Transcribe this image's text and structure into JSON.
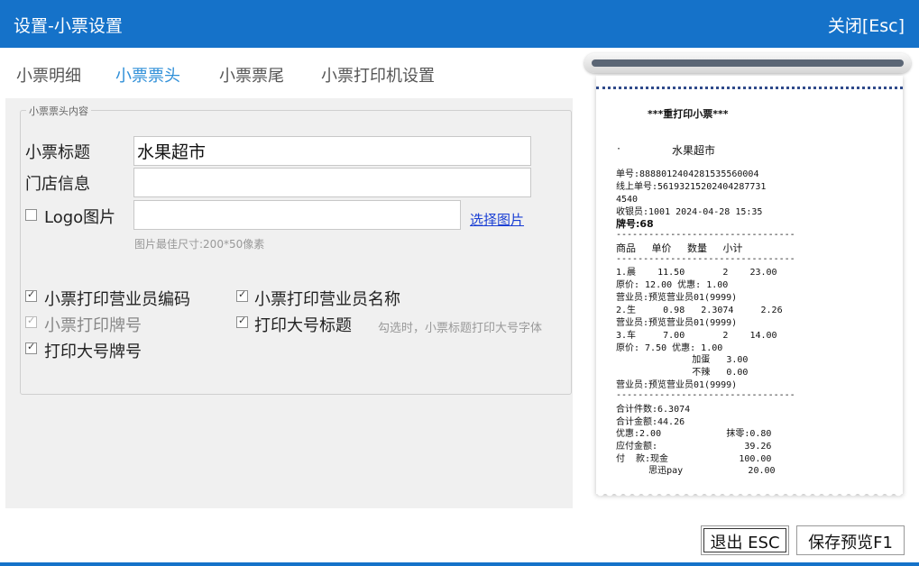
{
  "window": {
    "title": "设置-小票设置",
    "close_label": "关闭[Esc]"
  },
  "tabs": [
    {
      "label": "小票明细",
      "active": false
    },
    {
      "label": "小票票头",
      "active": true
    },
    {
      "label": "小票票尾",
      "active": false
    },
    {
      "label": "小票打印机设置",
      "active": false
    }
  ],
  "form": {
    "group_title": "小票票头内容",
    "title_label": "小票标题",
    "title_value": "水果超市",
    "store_label": "门店信息",
    "store_value": "",
    "logo_label": "Logo图片",
    "logo_checked": false,
    "logo_value": "",
    "choose_image": "选择图片",
    "image_hint": "图片最佳尺寸:200*50像素",
    "options": [
      {
        "label": "小票打印营业员编码",
        "checked": true,
        "disabled": false
      },
      {
        "label": "小票打印营业员名称",
        "checked": true,
        "disabled": false
      },
      {
        "label": "小票打印牌号",
        "checked": true,
        "disabled": true
      },
      {
        "label": "打印大号标题",
        "checked": true,
        "disabled": false
      },
      {
        "label": "打印大号牌号",
        "checked": true,
        "disabled": false
      }
    ],
    "big_title_hint": "勾选时，小票标题打印大号字体"
  },
  "receipt": {
    "reprint": "***重打印小票***",
    "dot": "·",
    "shop": "水果超市",
    "lines": [
      "单号:888801240428153556000​4",
      "线上单号:56193215202404287731",
      "4540",
      "收银员:1001 2024-04-28 15:35"
    ],
    "plate": "牌号:68",
    "sep": "---------------------------------",
    "header": "商品     单价     数量     小计",
    "items": [
      "1.晨    11.50       2    23.00",
      "原价: 12.00 优惠: 1.00",
      "营业员:预览营业员01(9999)",
      "2.生     0.98   2.3074     2.26",
      "营业员:预览营业员01(9999)",
      "3.车     7.00       2    14.00",
      "原价: 7.50 优惠: 1.00",
      "              加蛋   3.00",
      "              不辣   0.00",
      "营业员:预览营业员01(9999)"
    ],
    "totals": [
      "合计件数:6.3074",
      "合计金额:44.26",
      "优惠:2.00            抹零:0.80",
      "应付金额:                39.26",
      "付  款:现金             100.00",
      "      思迅pay            20.00"
    ]
  },
  "buttons": {
    "exit": "退出 ESC",
    "save_preview": "保存预览F1"
  },
  "colors": {
    "accent": "#1572c9",
    "active_tab": "#2f8fd8",
    "link": "#1a3fd4"
  }
}
